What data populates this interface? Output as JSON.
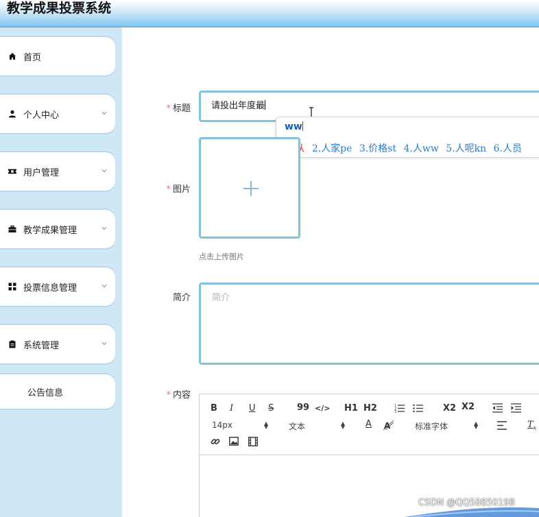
{
  "app": {
    "title": "教学成果投票系统"
  },
  "sidebar": {
    "items": [
      {
        "label": "首页",
        "icon": "home-icon"
      },
      {
        "label": "个人中心",
        "icon": "user-icon"
      },
      {
        "label": "用户管理",
        "icon": "ticket-icon"
      },
      {
        "label": "教学成果管理",
        "icon": "briefcase-icon"
      },
      {
        "label": "投票信息管理",
        "icon": "grid-icon"
      },
      {
        "label": "系统管理",
        "icon": "clipboard-icon"
      },
      {
        "label": "公告信息",
        "icon": ""
      }
    ]
  },
  "form": {
    "title_label": "标题",
    "title_value": "请投出年度最",
    "image_label": "图片",
    "upload_hint": "点击上传图片",
    "intro_label": "简介",
    "intro_placeholder": "简介",
    "content_label": "内容",
    "required_mark": "*"
  },
  "ime": {
    "composition": "ww",
    "candidates": [
      "1.从",
      "2.人家pe",
      "3.价格st",
      "4.人ww",
      "5.人呢kn",
      "6.人员"
    ]
  },
  "editor": {
    "font_size": "14px",
    "text_type": "文本",
    "font_family": "标准字体",
    "buttons": [
      "B",
      "I",
      "U",
      "S",
      "99",
      "</>",
      "H1",
      "H2",
      "ordered-list",
      "bullet-list",
      "X2",
      "X2",
      "outdent",
      "indent",
      "A",
      "highlight",
      "align",
      "clear-format",
      "link",
      "image",
      "video"
    ]
  },
  "watermark": "CSDN @QQ58850198",
  "colors": {
    "accent": "#7fc3df",
    "sidebar_bg": "#d0e8f6",
    "required": "#f56c6c",
    "ime_candidate": "#2b7bc4",
    "ime_selected": "#d9302b"
  }
}
